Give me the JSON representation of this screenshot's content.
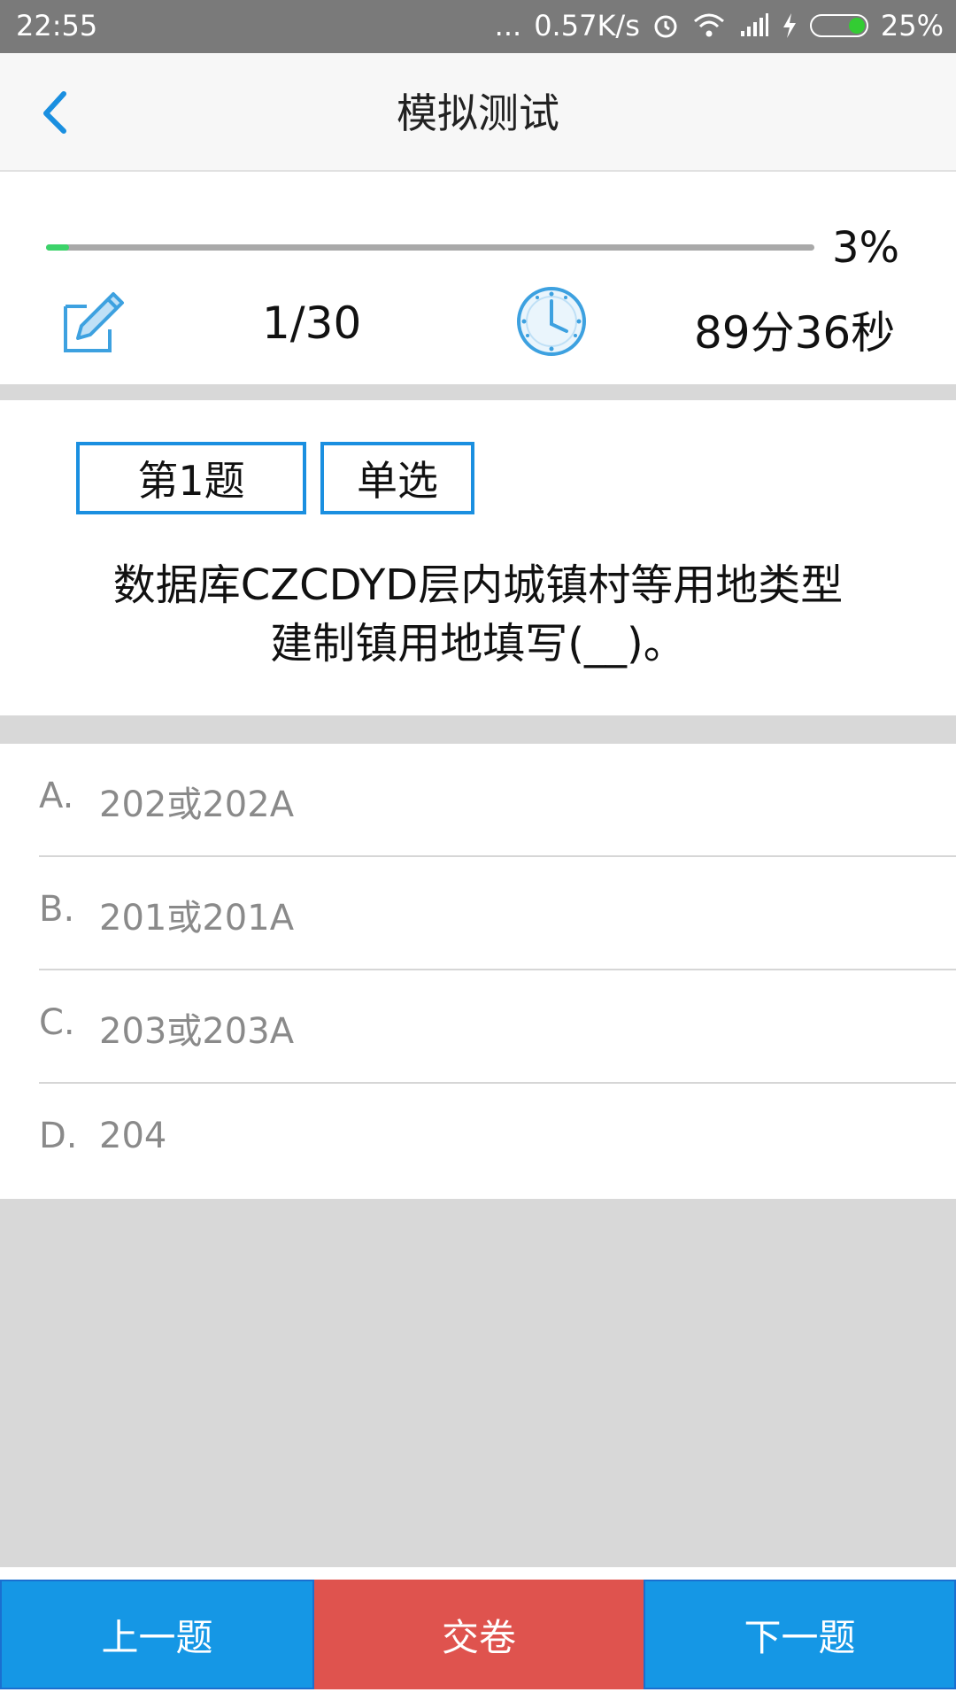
{
  "status_bar": {
    "time": "22:55",
    "dots": "...",
    "speed": "0.57K/s",
    "battery": "25%",
    "battery_color": "#33cc33"
  },
  "header": {
    "title": "模拟测试",
    "accent_color": "#1a8fe0"
  },
  "progress": {
    "percent_text": "3%",
    "fraction": 0.03,
    "count": "1/30",
    "time_left": "89分36秒",
    "fill_color": "#3cd36a"
  },
  "question": {
    "number_label": "第1题",
    "type_label": "单选",
    "text_line1": "数据库CZCDYD层内城镇村等用地类型",
    "text_line2": "建制镇用地填写(__)。"
  },
  "options": [
    {
      "letter": "A.",
      "text": "202或202A"
    },
    {
      "letter": "B.",
      "text": "201或201A"
    },
    {
      "letter": "C.",
      "text": "203或203A"
    },
    {
      "letter": "D.",
      "text": "204"
    }
  ],
  "bottom_bar": {
    "prev_label": "上一题",
    "submit_label": "交卷",
    "next_label": "下一题",
    "primary_color": "#1597e5",
    "submit_color": "#df534e"
  }
}
